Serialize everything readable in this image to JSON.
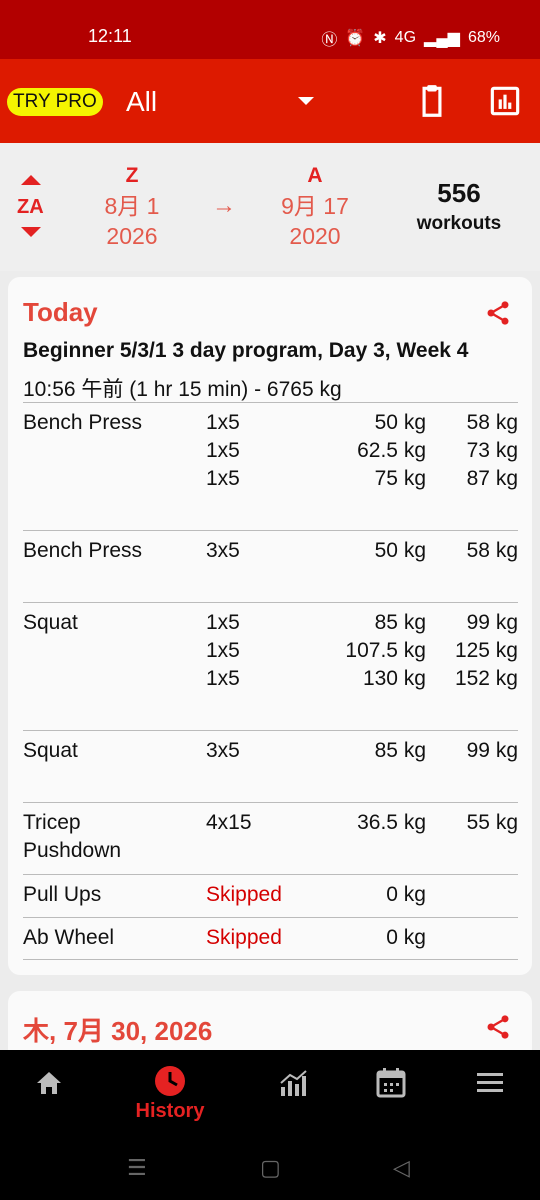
{
  "status": {
    "time": "12:11",
    "battery": "68%",
    "network": "4G"
  },
  "app_bar": {
    "try_pro": "TRY PRO",
    "filter": "All",
    "icons": [
      "clipboard-icon",
      "chart-icon"
    ]
  },
  "date_range": {
    "sort_label": "ZA",
    "from_header": "Z",
    "from_line1": "8月 1",
    "from_line2": "2026",
    "to_header": "A",
    "to_line1": "9月 17",
    "to_line2": "2020",
    "arrow": "→",
    "count": "556",
    "count_label": "workouts"
  },
  "workout": {
    "date": "Today",
    "program": "Beginner 5/3/1 3 day program, Day 3, Week 4",
    "meta": "10:56 午前 (1 hr 15 min) - 6765 kg",
    "exercises": [
      {
        "name": "Bench Press",
        "rows": [
          {
            "sets": "1x5",
            "w1": "50 kg",
            "w2": "58 kg"
          },
          {
            "sets": "1x5",
            "w1": "62.5 kg",
            "w2": "73 kg"
          },
          {
            "sets": "1x5",
            "w1": "75 kg",
            "w2": "87 kg"
          }
        ]
      },
      {
        "name": "Bench Press",
        "rows": [
          {
            "sets": "3x5",
            "w1": "50 kg",
            "w2": "58 kg"
          }
        ]
      },
      {
        "name": "Squat",
        "rows": [
          {
            "sets": "1x5",
            "w1": "85 kg",
            "w2": "99 kg"
          },
          {
            "sets": "1x5",
            "w1": "107.5 kg",
            "w2": "125 kg"
          },
          {
            "sets": "1x5",
            "w1": "130 kg",
            "w2": "152 kg"
          }
        ]
      },
      {
        "name": "Squat",
        "rows": [
          {
            "sets": "3x5",
            "w1": "85 kg",
            "w2": "99 kg"
          }
        ]
      },
      {
        "name_line1": "Tricep",
        "name_line2": "Pushdown",
        "rows": [
          {
            "sets": "4x15",
            "w1": "36.5 kg",
            "w2": "55 kg"
          }
        ]
      },
      {
        "name": "Pull Ups",
        "rows": [
          {
            "sets": "Skipped",
            "w1": "0 kg",
            "w2": ""
          }
        ]
      },
      {
        "name": "Ab Wheel",
        "rows": [
          {
            "sets": "Skipped",
            "w1": "0 kg",
            "w2": ""
          }
        ]
      }
    ]
  },
  "next_workout": {
    "date": "木, 7月 30, 2026"
  },
  "bottom_nav": {
    "active_label": "History",
    "items": [
      "home-icon",
      "history-icon",
      "progress-chart-icon",
      "calendar-icon",
      "menu-icon"
    ]
  },
  "colors": {
    "status_bar": "#b20000",
    "app_bar": "#dd1a00",
    "accent": "#e3473a",
    "try_pro_bg": "#f5f500",
    "skipped": "#d40000"
  }
}
